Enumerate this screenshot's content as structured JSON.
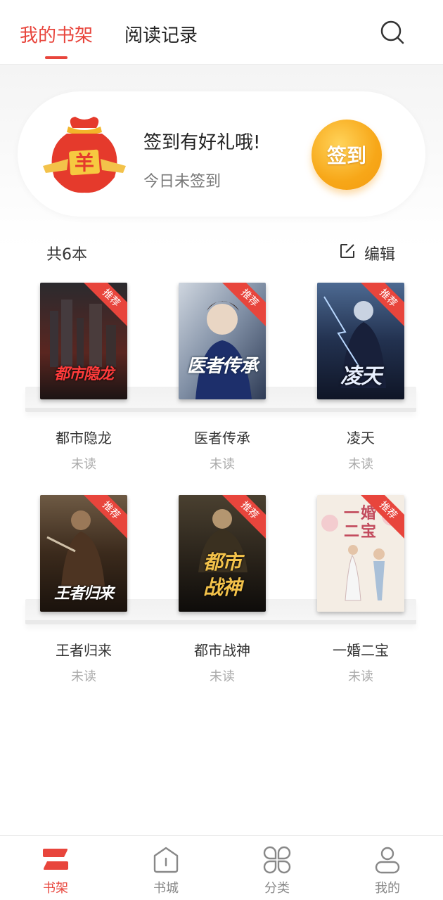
{
  "header": {
    "tabs": [
      {
        "label": "我的书架",
        "active": true
      },
      {
        "label": "阅读记录",
        "active": false
      }
    ],
    "search_icon": "search-icon"
  },
  "signin": {
    "title": "签到有好礼哦!",
    "subtitle": "今日未签到",
    "button_label": "签到",
    "bag_text": "羊"
  },
  "shelf": {
    "count_label": "共6本",
    "edit_label": "编辑",
    "badge": "推荐",
    "books": [
      {
        "cover_title": "都市隐龙",
        "name": "都市隐龙",
        "status": "未读",
        "cover_color": "#3a2020"
      },
      {
        "cover_title": "医者传承",
        "name": "医者传承",
        "status": "未读",
        "cover_color": "#5d6a80"
      },
      {
        "cover_title": "凌天",
        "name": "凌天",
        "status": "未读",
        "cover_color": "#1e2a48"
      },
      {
        "cover_title": "王者归来",
        "name": "王者归来",
        "status": "未读",
        "cover_color": "#3b2a1c"
      },
      {
        "cover_title": "都市战神",
        "name": "都市战神",
        "status": "未读",
        "cover_color": "#262018"
      },
      {
        "cover_title": "一婚二宝",
        "name": "一婚二宝",
        "status": "未读",
        "cover_color": "#f4ede4"
      }
    ]
  },
  "bottom_nav": [
    {
      "label": "书架",
      "icon": "bookshelf-icon",
      "active": true
    },
    {
      "label": "书城",
      "icon": "bookstore-icon",
      "active": false
    },
    {
      "label": "分类",
      "icon": "category-icon",
      "active": false
    },
    {
      "label": "我的",
      "icon": "profile-icon",
      "active": false
    }
  ],
  "colors": {
    "accent": "#e8453c",
    "signin_button": "#f7a718"
  }
}
